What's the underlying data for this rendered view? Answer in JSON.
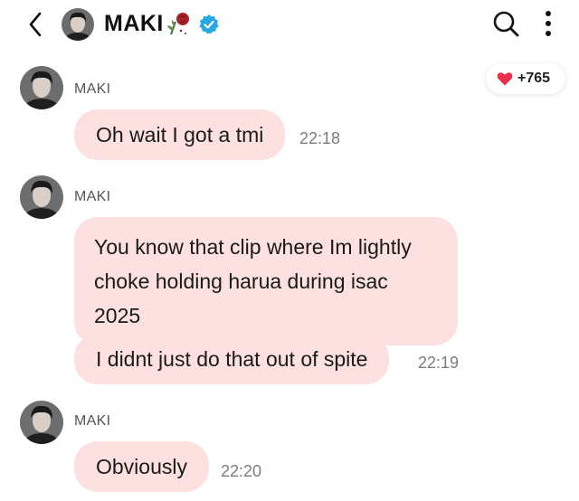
{
  "header": {
    "name": "MAKI",
    "icons": {
      "back": "chevron-left-icon",
      "rose": "rose-icon",
      "verified": "verified-badge-icon",
      "search": "search-icon",
      "more": "more-vertical-icon"
    }
  },
  "likes": {
    "count": "+765",
    "icon": "heart-icon",
    "color": "#e8334a"
  },
  "colors": {
    "bubble": "#fde0e0",
    "verified": "#27a8e0"
  },
  "messages": [
    {
      "sender": "MAKI",
      "text": "Oh wait I got a tmi",
      "time": "22:18"
    },
    {
      "sender": "MAKI",
      "text": "You know that clip where Im lightly choke holding harua during isac 2025",
      "time": ""
    },
    {
      "sender": "",
      "text": "I didnt just do that out of spite",
      "time": "22:19"
    },
    {
      "sender": "MAKI",
      "text": "Obviously",
      "time": "22:20"
    }
  ]
}
